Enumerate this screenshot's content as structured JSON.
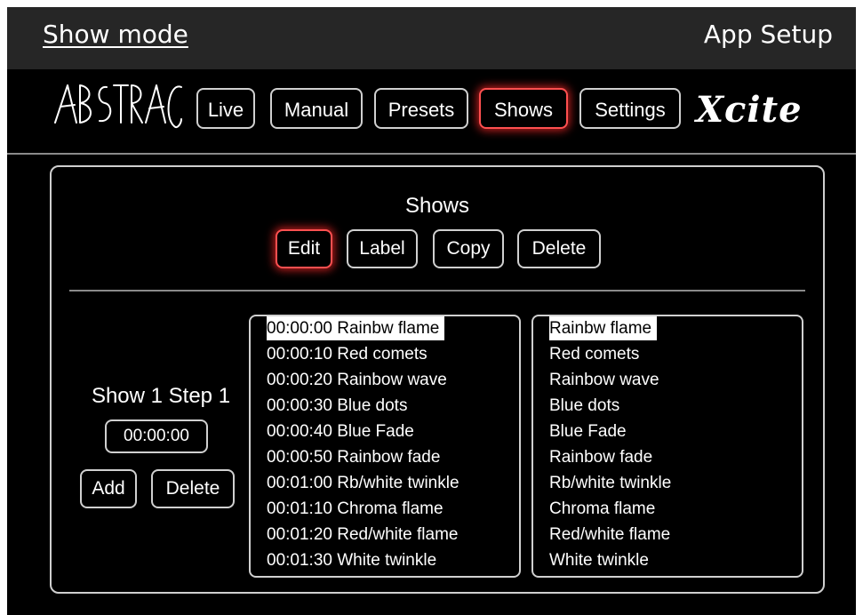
{
  "top_bar": {
    "left_link": "Show mode",
    "right_link": "App Setup"
  },
  "nav": {
    "logo_left": "ABSTRACT",
    "logo_right": "Xcite",
    "buttons": [
      {
        "label": "Live",
        "active": false
      },
      {
        "label": "Manual",
        "active": false
      },
      {
        "label": "Presets",
        "active": false
      },
      {
        "label": "Shows",
        "active": true
      },
      {
        "label": "Settings",
        "active": false
      }
    ]
  },
  "panel": {
    "title": "Shows",
    "actions": {
      "edit": "Edit",
      "label": "Label",
      "copy": "Copy",
      "delete": "Delete"
    },
    "step": {
      "title": "Show 1 Step 1",
      "time": "00:00:00",
      "add": "Add",
      "delete": "Delete"
    },
    "timeline": [
      {
        "label": "00:00:00 Rainbw flame",
        "selected": true
      },
      {
        "label": "00:00:10 Red comets",
        "selected": false
      },
      {
        "label": "00:00:20 Rainbow wave",
        "selected": false
      },
      {
        "label": "00:00:30 Blue dots",
        "selected": false
      },
      {
        "label": "00:00:40 Blue Fade",
        "selected": false
      },
      {
        "label": "00:00:50 Rainbow fade",
        "selected": false
      },
      {
        "label": "00:01:00 Rb/white twinkle",
        "selected": false
      },
      {
        "label": "00:01:10 Chroma flame",
        "selected": false
      },
      {
        "label": "00:01:20 Red/white flame",
        "selected": false
      },
      {
        "label": "00:01:30 White twinkle",
        "selected": false
      }
    ],
    "presets": [
      {
        "label": "Rainbw flame",
        "selected": true
      },
      {
        "label": "Red comets",
        "selected": false
      },
      {
        "label": "Rainbow wave",
        "selected": false
      },
      {
        "label": "Blue dots",
        "selected": false
      },
      {
        "label": "Blue Fade",
        "selected": false
      },
      {
        "label": "Rainbow fade",
        "selected": false
      },
      {
        "label": "Rb/white twinkle",
        "selected": false
      },
      {
        "label": "Chroma flame",
        "selected": false
      },
      {
        "label": "Red/white flame",
        "selected": false
      },
      {
        "label": "White twinkle",
        "selected": false
      }
    ]
  },
  "colors": {
    "background": "#000000",
    "top_bar": "#262626",
    "text": "#ffffff",
    "active_glow": "#ff3030",
    "border": "#d0d0d0"
  }
}
